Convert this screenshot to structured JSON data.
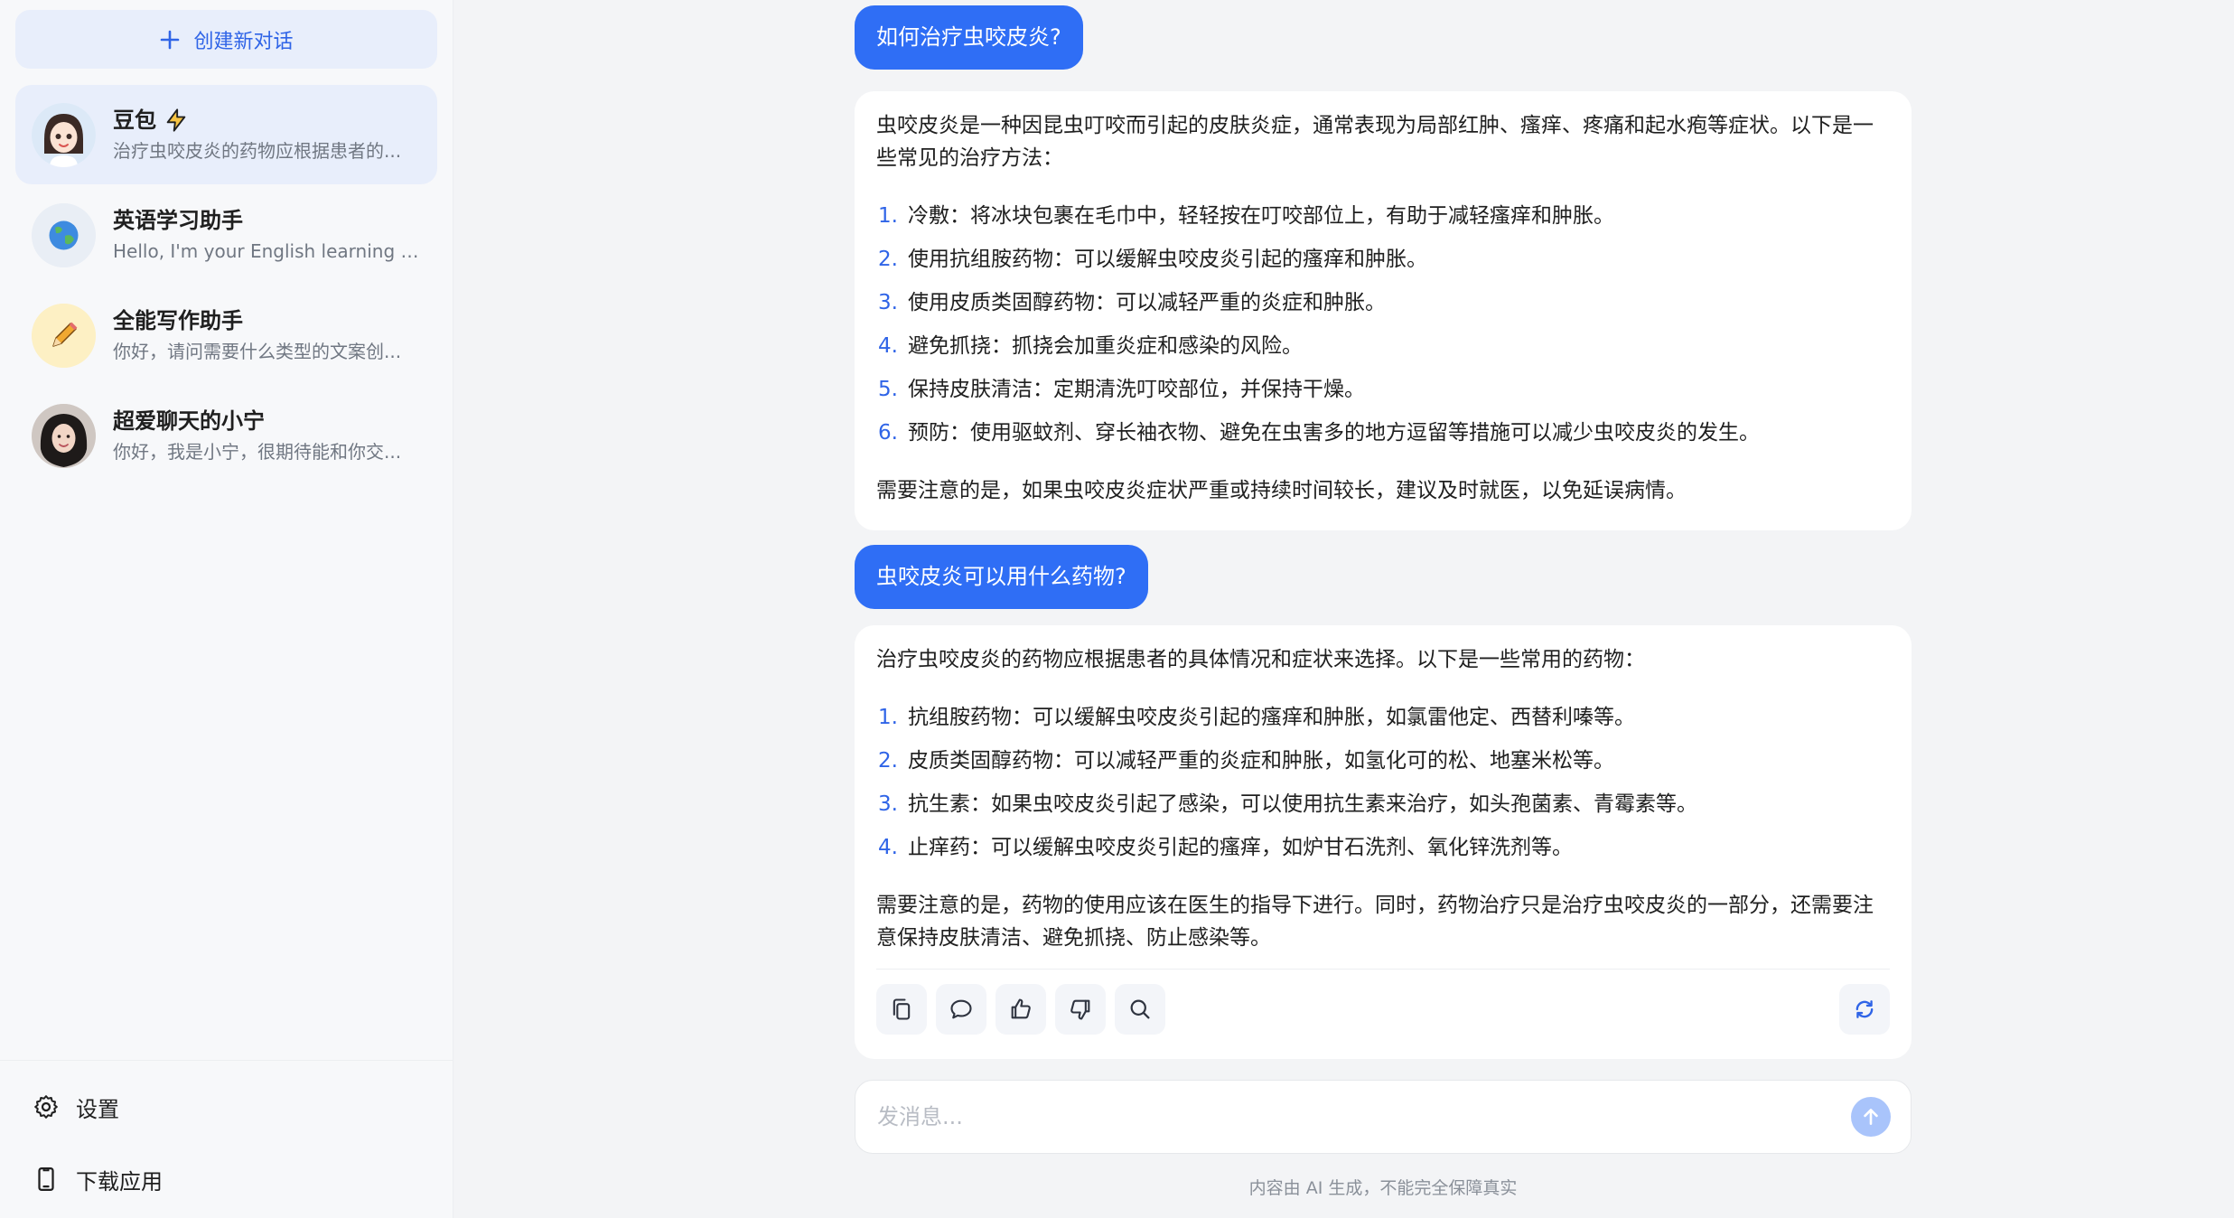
{
  "sidebar": {
    "new_chat_label": "创建新对话",
    "conversations": [
      {
        "title": "豆包",
        "subtitle": "治疗虫咬皮炎的药物应根据患者的..."
      },
      {
        "title": "英语学习助手",
        "subtitle": "Hello, I'm your English learning ass..."
      },
      {
        "title": "全能写作助手",
        "subtitle": "你好，请问需要什么类型的文案创..."
      },
      {
        "title": "超爱聊天的小宁",
        "subtitle": "你好，我是小宁，很期待能和你交..."
      }
    ],
    "settings_label": "设置",
    "download_label": "下载应用"
  },
  "chat": {
    "q1": "如何治疗虫咬皮炎?",
    "a1": {
      "intro": "虫咬皮炎是一种因昆虫叮咬而引起的皮肤炎症，通常表现为局部红肿、瘙痒、疼痛和起水疱等症状。以下是一些常见的治疗方法：",
      "items": [
        {
          "num": "1.",
          "text": "冷敷：将冰块包裹在毛巾中，轻轻按在叮咬部位上，有助于减轻瘙痒和肿胀。"
        },
        {
          "num": "2.",
          "text": "使用抗组胺药物：可以缓解虫咬皮炎引起的瘙痒和肿胀。"
        },
        {
          "num": "3.",
          "text": "使用皮质类固醇药物：可以减轻严重的炎症和肿胀。"
        },
        {
          "num": "4.",
          "text": "避免抓挠：抓挠会加重炎症和感染的风险。"
        },
        {
          "num": "5.",
          "text": "保持皮肤清洁：定期清洗叮咬部位，并保持干燥。"
        },
        {
          "num": "6.",
          "text": "预防：使用驱蚊剂、穿长袖衣物、避免在虫害多的地方逗留等措施可以减少虫咬皮炎的发生。"
        }
      ],
      "outro": "需要注意的是，如果虫咬皮炎症状严重或持续时间较长，建议及时就医，以免延误病情。"
    },
    "q2": "虫咬皮炎可以用什么药物?",
    "a2": {
      "intro": "治疗虫咬皮炎的药物应根据患者的具体情况和症状来选择。以下是一些常用的药物：",
      "items": [
        {
          "num": "1.",
          "text": "抗组胺药物：可以缓解虫咬皮炎引起的瘙痒和肿胀，如氯雷他定、西替利嗪等。"
        },
        {
          "num": "2.",
          "text": "皮质类固醇药物：可以减轻严重的炎症和肿胀，如氢化可的松、地塞米松等。"
        },
        {
          "num": "3.",
          "text": "抗生素：如果虫咬皮炎引起了感染，可以使用抗生素来治疗，如头孢菌素、青霉素等。"
        },
        {
          "num": "4.",
          "text": "止痒药：可以缓解虫咬皮炎引起的瘙痒，如炉甘石洗剂、氧化锌洗剂等。"
        }
      ],
      "outro": "需要注意的是，药物的使用应该在医生的指导下进行。同时，药物治疗只是治疗虫咬皮炎的一部分，还需要注意保持皮肤清洁、避免抓挠、防止感染等。"
    }
  },
  "composer": {
    "placeholder": "发消息..."
  },
  "footnote": "内容由 AI 生成，不能完全保障真实",
  "colors": {
    "accent": "#2f6ef5",
    "active_bg": "#e8eefb"
  }
}
